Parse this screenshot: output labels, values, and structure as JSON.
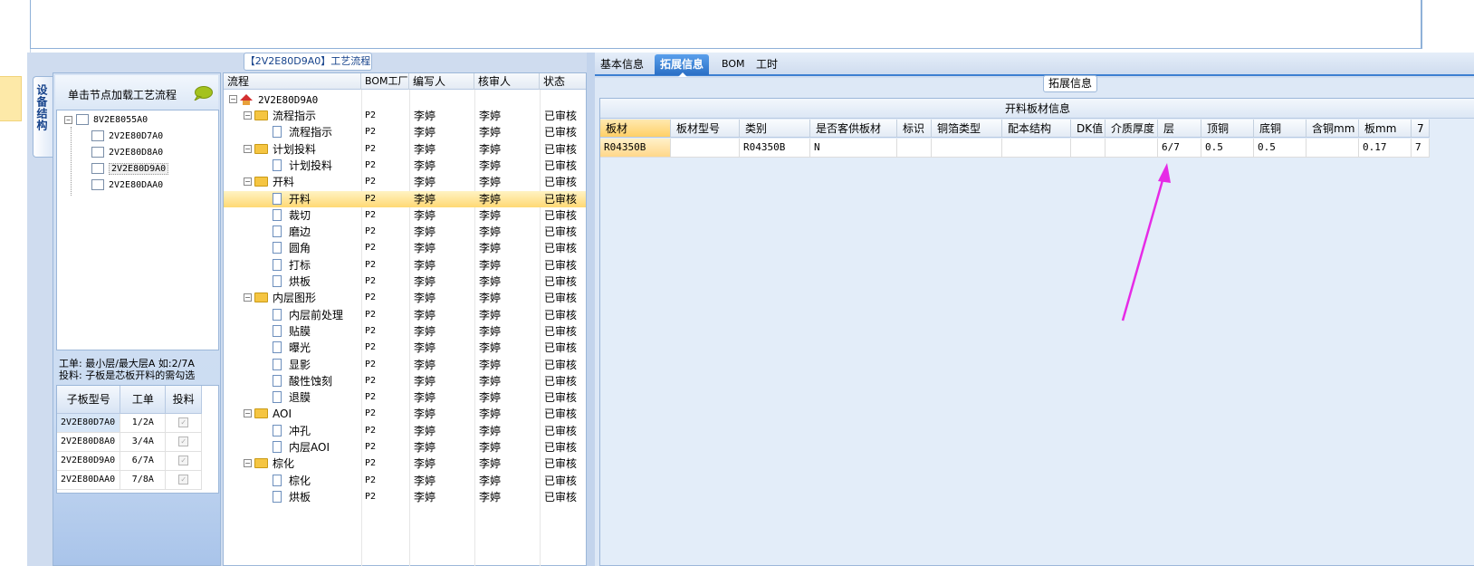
{
  "sidebar_tab": "设备结构",
  "left_panel": {
    "header": "单击节点加载工艺流程",
    "tree": {
      "root": "8V2E8055A0",
      "children": [
        "2V2E80D7A0",
        "2V2E80D8A0",
        "2V2E80D9A0",
        "2V2E80DAA0"
      ]
    },
    "note_line1": "工单: 最小层/最大层A 如:2/7A",
    "note_line2": "投料: 子板是芯板开料的需勾选",
    "sub_table": {
      "headers": [
        "子板型号",
        "工单",
        "投料"
      ],
      "rows": [
        [
          "2V2E80D7A0",
          "1/2A",
          "✓"
        ],
        [
          "2V2E80D8A0",
          "3/4A",
          "✓"
        ],
        [
          "2V2E80D9A0",
          "6/7A",
          "✓"
        ],
        [
          "2V2E80DAA0",
          "7/8A",
          "✓"
        ]
      ]
    }
  },
  "flow_panel": {
    "title": "【2V2E80D9A0】工艺流程",
    "headers": [
      "流程",
      "BOM工厂",
      "编写人",
      "核审人",
      "状态"
    ],
    "root": "2V2E80D9A0",
    "rows": [
      {
        "name": "流程指示",
        "level": 1,
        "factory": "P2",
        "writer": "李婷",
        "reviewer": "李婷",
        "status": "已审核"
      },
      {
        "name": "流程指示",
        "level": 2,
        "factory": "P2",
        "writer": "李婷",
        "reviewer": "李婷",
        "status": "已审核"
      },
      {
        "name": "计划投料",
        "level": 1,
        "factory": "P2",
        "writer": "李婷",
        "reviewer": "李婷",
        "status": "已审核"
      },
      {
        "name": "计划投料",
        "level": 2,
        "factory": "P2",
        "writer": "李婷",
        "reviewer": "李婷",
        "status": "已审核"
      },
      {
        "name": "开料",
        "level": 1,
        "factory": "P2",
        "writer": "李婷",
        "reviewer": "李婷",
        "status": "已审核"
      },
      {
        "name": "开料",
        "level": 2,
        "factory": "P2",
        "writer": "李婷",
        "reviewer": "李婷",
        "status": "已审核",
        "selected": true
      },
      {
        "name": "裁切",
        "level": 2,
        "factory": "P2",
        "writer": "李婷",
        "reviewer": "李婷",
        "status": "已审核"
      },
      {
        "name": "磨边",
        "level": 2,
        "factory": "P2",
        "writer": "李婷",
        "reviewer": "李婷",
        "status": "已审核"
      },
      {
        "name": "圆角",
        "level": 2,
        "factory": "P2",
        "writer": "李婷",
        "reviewer": "李婷",
        "status": "已审核"
      },
      {
        "name": "打标",
        "level": 2,
        "factory": "P2",
        "writer": "李婷",
        "reviewer": "李婷",
        "status": "已审核"
      },
      {
        "name": "烘板",
        "level": 2,
        "factory": "P2",
        "writer": "李婷",
        "reviewer": "李婷",
        "status": "已审核"
      },
      {
        "name": "内层图形",
        "level": 1,
        "factory": "P2",
        "writer": "李婷",
        "reviewer": "李婷",
        "status": "已审核"
      },
      {
        "name": "内层前处理",
        "level": 2,
        "factory": "P2",
        "writer": "李婷",
        "reviewer": "李婷",
        "status": "已审核"
      },
      {
        "name": "贴膜",
        "level": 2,
        "factory": "P2",
        "writer": "李婷",
        "reviewer": "李婷",
        "status": "已审核"
      },
      {
        "name": "曝光",
        "level": 2,
        "factory": "P2",
        "writer": "李婷",
        "reviewer": "李婷",
        "status": "已审核"
      },
      {
        "name": "显影",
        "level": 2,
        "factory": "P2",
        "writer": "李婷",
        "reviewer": "李婷",
        "status": "已审核"
      },
      {
        "name": "酸性蚀刻",
        "level": 2,
        "factory": "P2",
        "writer": "李婷",
        "reviewer": "李婷",
        "status": "已审核"
      },
      {
        "name": "退膜",
        "level": 2,
        "factory": "P2",
        "writer": "李婷",
        "reviewer": "李婷",
        "status": "已审核"
      },
      {
        "name": "AOI",
        "level": 1,
        "factory": "P2",
        "writer": "李婷",
        "reviewer": "李婷",
        "status": "已审核"
      },
      {
        "name": "冲孔",
        "level": 2,
        "factory": "P2",
        "writer": "李婷",
        "reviewer": "李婷",
        "status": "已审核"
      },
      {
        "name": "内层AOI",
        "level": 2,
        "factory": "P2",
        "writer": "李婷",
        "reviewer": "李婷",
        "status": "已审核"
      },
      {
        "name": "棕化",
        "level": 1,
        "factory": "P2",
        "writer": "李婷",
        "reviewer": "李婷",
        "status": "已审核"
      },
      {
        "name": "棕化",
        "level": 2,
        "factory": "P2",
        "writer": "李婷",
        "reviewer": "李婷",
        "status": "已审核"
      },
      {
        "name": "烘板",
        "level": 2,
        "factory": "P2",
        "writer": "李婷",
        "reviewer": "李婷",
        "status": "已审核"
      }
    ]
  },
  "right_panel": {
    "tabs": [
      "基本信息",
      "拓展信息",
      "BOM",
      "工时"
    ],
    "active_tab": "拓展信息",
    "group_legend": "拓展信息",
    "grid_caption": "开料板材信息",
    "grid_headers": [
      "板材",
      "板材型号",
      "类别",
      "是否客供板材",
      "标识",
      "铜箔类型",
      "配本结构",
      "DK值",
      "介质厚度",
      "层",
      "顶铜",
      "底铜",
      "含铜mm",
      "板mm",
      "7"
    ],
    "grid_row": [
      "R04350B",
      "",
      "R04350B",
      "N",
      "",
      "",
      "",
      "",
      "",
      "6/7",
      "0.5",
      "0.5",
      "",
      "0.17",
      "7"
    ]
  },
  "colors": {
    "accent": "#2b6fc5",
    "selection": "#ffd974",
    "annotation_arrow": "#e62be6"
  }
}
